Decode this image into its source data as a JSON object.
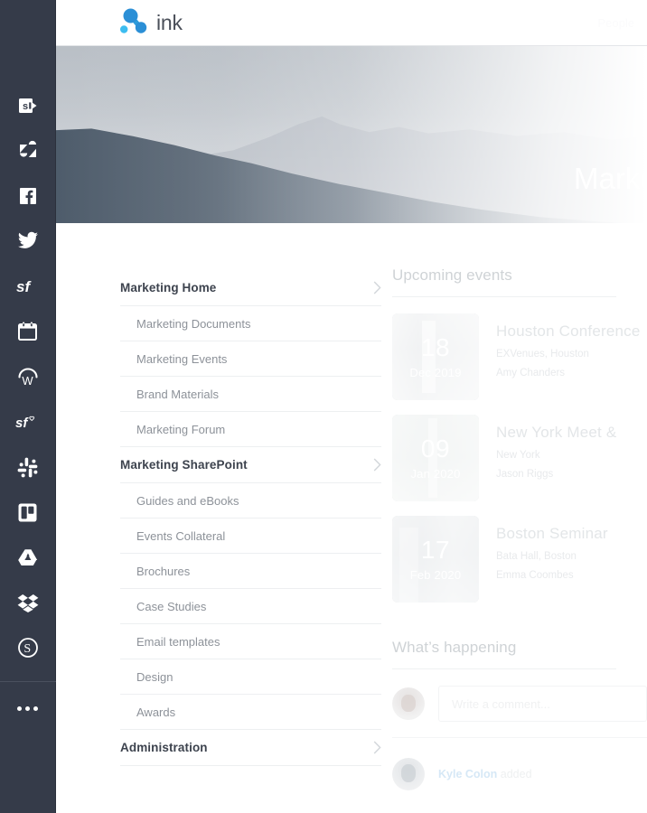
{
  "app": {
    "brand_name": "ink",
    "brand_icon": "molecule-logo-icon"
  },
  "topbar": {
    "links": [
      {
        "label": "People",
        "icon": "people-nav-link"
      }
    ]
  },
  "hero": {
    "title": "Marketing",
    "image_alt": "mountain-landscape-banner"
  },
  "rail": {
    "items": [
      {
        "name": "sharepoint",
        "label": "SharePoint",
        "icon": "sharepoint-icon"
      },
      {
        "name": "zendesk",
        "label": "Zendesk",
        "icon": "zendesk-icon"
      },
      {
        "name": "facebook",
        "label": "Facebook",
        "icon": "facebook-icon"
      },
      {
        "name": "twitter",
        "label": "Twitter",
        "icon": "twitter-icon"
      },
      {
        "name": "salesforce",
        "label": "Salesforce",
        "icon": "salesforce-icon"
      },
      {
        "name": "calendar",
        "label": "Calendar",
        "icon": "calendar-icon"
      },
      {
        "name": "workfront",
        "label": "Workfront",
        "icon": "workfront-icon"
      },
      {
        "name": "salesforce-chatter",
        "label": "Salesforce Chatter",
        "icon": "salesforce-heart-icon"
      },
      {
        "name": "slack",
        "label": "Slack",
        "icon": "slack-icon"
      },
      {
        "name": "trello",
        "label": "Trello",
        "icon": "trello-icon"
      },
      {
        "name": "google-drive",
        "label": "Google Drive",
        "icon": "google-drive-icon"
      },
      {
        "name": "dropbox",
        "label": "Dropbox",
        "icon": "dropbox-icon"
      },
      {
        "name": "skype",
        "label": "Skype",
        "icon": "skype-icon"
      }
    ],
    "more_label": "More apps",
    "more_icon": "ellipsis-icon"
  },
  "nav": {
    "rows": [
      {
        "label": "Marketing Home",
        "type": "parent",
        "chevron": "chevron-right-icon"
      },
      {
        "label": "Marketing Documents",
        "type": "child"
      },
      {
        "label": "Marketing Events",
        "type": "child"
      },
      {
        "label": "Brand Materials",
        "type": "child"
      },
      {
        "label": "Marketing Forum",
        "type": "child"
      },
      {
        "label": "Marketing SharePoint",
        "type": "parent",
        "chevron": "chevron-right-icon"
      },
      {
        "label": "Guides and eBooks",
        "type": "child"
      },
      {
        "label": "Events Collateral",
        "type": "child"
      },
      {
        "label": "Brochures",
        "type": "child"
      },
      {
        "label": "Case Studies",
        "type": "child"
      },
      {
        "label": "Email templates",
        "type": "child"
      },
      {
        "label": "Design",
        "type": "child"
      },
      {
        "label": "Awards",
        "type": "child"
      },
      {
        "label": "Administration",
        "type": "parent",
        "chevron": "chevron-right-icon"
      }
    ]
  },
  "events": {
    "heading": "Upcoming events",
    "items": [
      {
        "day": "18",
        "month": "Dec 2019",
        "title": "Houston Conference",
        "place": "EXVenues, Houston",
        "person": "Amy Chanders",
        "thumb": "photo-houston"
      },
      {
        "day": "09",
        "month": "Jan 2020",
        "title": "New York Meet &",
        "place": "New York",
        "person": "Jason Riggs",
        "thumb": "photo-newyork"
      },
      {
        "day": "17",
        "month": "Feb 2020",
        "title": "Boston Seminar",
        "place": "Bata Hall, Boston",
        "person": "Emma Coombes",
        "thumb": "photo-boston"
      }
    ]
  },
  "happening": {
    "heading": "What’s happening",
    "comment_placeholder": "Write a comment...",
    "feed": [
      {
        "name": "Kyle Colon",
        "action": "added"
      }
    ]
  }
}
